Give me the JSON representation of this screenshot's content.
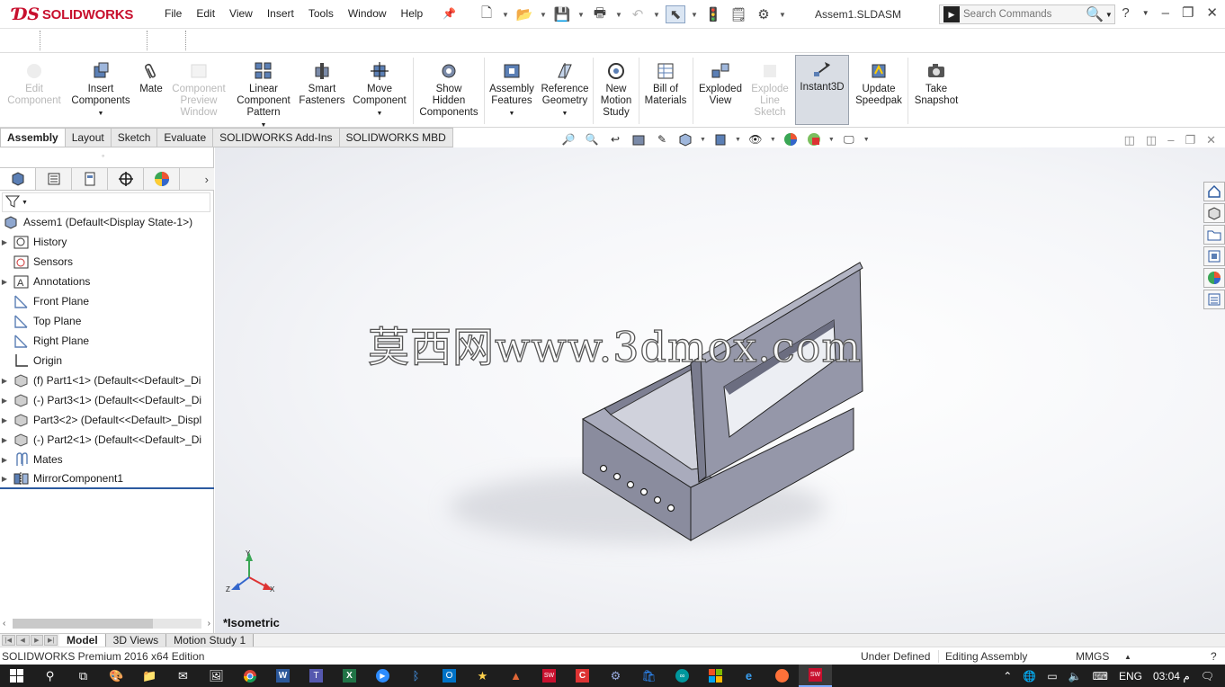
{
  "titlebar": {
    "app_name": "SOLIDWORKS",
    "menus": [
      "File",
      "Edit",
      "View",
      "Insert",
      "Tools",
      "Window",
      "Help"
    ],
    "document_title": "Assem1.SLDASM",
    "search_placeholder": "Search Commands"
  },
  "command_manager": {
    "buttons": [
      {
        "label1": "Edit",
        "label2": "Component",
        "label3": "",
        "disabled": true
      },
      {
        "label1": "Insert",
        "label2": "Components",
        "label3": "",
        "disabled": false
      },
      {
        "label1": "Mate",
        "label2": "",
        "label3": "",
        "disabled": false
      },
      {
        "label1": "Component",
        "label2": "Preview",
        "label3": "Window",
        "disabled": true
      },
      {
        "label1": "Linear",
        "label2": "Component",
        "label3": "Pattern",
        "disabled": false
      },
      {
        "label1": "Smart",
        "label2": "Fasteners",
        "label3": "",
        "disabled": false
      },
      {
        "label1": "Move",
        "label2": "Component",
        "label3": "",
        "disabled": false
      },
      {
        "label1": "Show",
        "label2": "Hidden",
        "label3": "Components",
        "disabled": false
      },
      {
        "label1": "Assembly",
        "label2": "Features",
        "label3": "",
        "disabled": false
      },
      {
        "label1": "Reference",
        "label2": "Geometry",
        "label3": "",
        "disabled": false
      },
      {
        "label1": "New",
        "label2": "Motion",
        "label3": "Study",
        "disabled": false
      },
      {
        "label1": "Bill of",
        "label2": "Materials",
        "label3": "",
        "disabled": false
      },
      {
        "label1": "Exploded",
        "label2": "View",
        "label3": "",
        "disabled": false
      },
      {
        "label1": "Explode",
        "label2": "Line",
        "label3": "Sketch",
        "disabled": true
      },
      {
        "label1": "Instant3D",
        "label2": "",
        "label3": "",
        "disabled": false
      },
      {
        "label1": "Update",
        "label2": "Speedpak",
        "label3": "",
        "disabled": false
      },
      {
        "label1": "Take",
        "label2": "Snapshot",
        "label3": "",
        "disabled": false
      }
    ]
  },
  "tabs": [
    "Assembly",
    "Layout",
    "Sketch",
    "Evaluate",
    "SOLIDWORKS Add-Ins",
    "SOLIDWORKS MBD"
  ],
  "feature_tree": {
    "root": "Assem1  (Default<Display State-1>)",
    "items": [
      {
        "label": "History",
        "expandable": true
      },
      {
        "label": "Sensors",
        "expandable": false
      },
      {
        "label": "Annotations",
        "expandable": true
      },
      {
        "label": "Front Plane",
        "expandable": false
      },
      {
        "label": "Top Plane",
        "expandable": false
      },
      {
        "label": "Right Plane",
        "expandable": false
      },
      {
        "label": "Origin",
        "expandable": false
      },
      {
        "label": "(f) Part1<1> (Default<<Default>_Di",
        "expandable": true
      },
      {
        "label": "(-) Part3<1> (Default<<Default>_Di",
        "expandable": true
      },
      {
        "label": "Part3<2> (Default<<Default>_Displ",
        "expandable": true
      },
      {
        "label": "(-) Part2<1> (Default<<Default>_Di",
        "expandable": true
      },
      {
        "label": "Mates",
        "expandable": true
      },
      {
        "label": "MirrorComponent1",
        "expandable": true
      }
    ]
  },
  "viewport": {
    "view_label": "*Isometric",
    "watermark": "莫西网www.3dmox.com",
    "triad": {
      "y": "Y",
      "z": "Z",
      "x": "X"
    }
  },
  "bottom_tabs": [
    "Model",
    "3D Views",
    "Motion Study 1"
  ],
  "status_bar": {
    "edition": "SOLIDWORKS Premium 2016 x64 Edition",
    "state": "Under Defined",
    "mode": "Editing Assembly",
    "units": "MMGS"
  },
  "taskbar": {
    "language": "ENG",
    "time": "03:04",
    "ampm": "م"
  },
  "colors": {
    "brand_red": "#c8102e",
    "model_gray": "#8a8c9e",
    "taskbar": "#1e1e1e"
  }
}
